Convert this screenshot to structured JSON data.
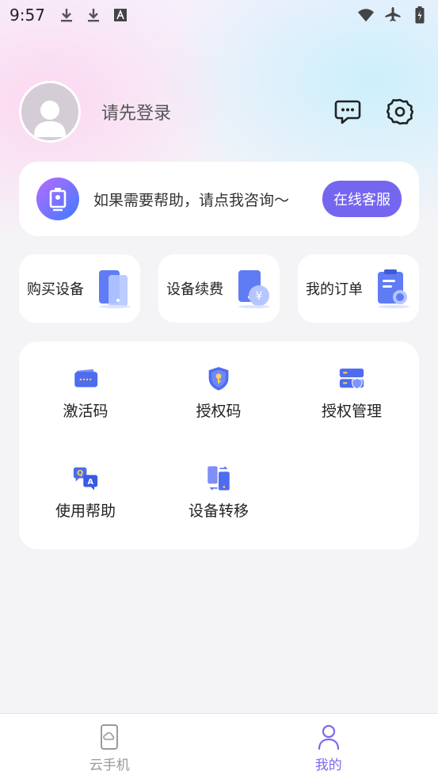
{
  "status_bar": {
    "time": "9:57",
    "left_icons": [
      "download-icon",
      "download-icon",
      "text-a-icon"
    ],
    "right_icons": [
      "wifi-icon",
      "airplane-icon",
      "battery-icon"
    ]
  },
  "profile": {
    "login_prompt": "请先登录",
    "actions": [
      "message-icon",
      "settings-icon"
    ]
  },
  "help_card": {
    "text": "如果需要帮助，请点我咨询～",
    "button_label": "在线客服"
  },
  "quick_actions": [
    {
      "label": "购买设备",
      "icon": "buy-device-icon"
    },
    {
      "label": "设备续费",
      "icon": "renew-device-icon"
    },
    {
      "label": "我的订单",
      "icon": "orders-icon"
    }
  ],
  "grid": {
    "items": [
      {
        "label": "激活码",
        "icon": "activation-code-icon"
      },
      {
        "label": "授权码",
        "icon": "auth-code-icon"
      },
      {
        "label": "授权管理",
        "icon": "auth-manage-icon"
      },
      {
        "label": "使用帮助",
        "icon": "help-qa-icon"
      },
      {
        "label": "设备转移",
        "icon": "device-transfer-icon"
      }
    ]
  },
  "tabs": [
    {
      "label": "云手机",
      "icon": "cloud-phone-icon",
      "active": false
    },
    {
      "label": "我的",
      "icon": "user-icon",
      "active": true
    }
  ],
  "colors": {
    "accent": "#7566f0",
    "tab_active": "#7b68ee",
    "icon_blue": "#4d6cf0"
  }
}
